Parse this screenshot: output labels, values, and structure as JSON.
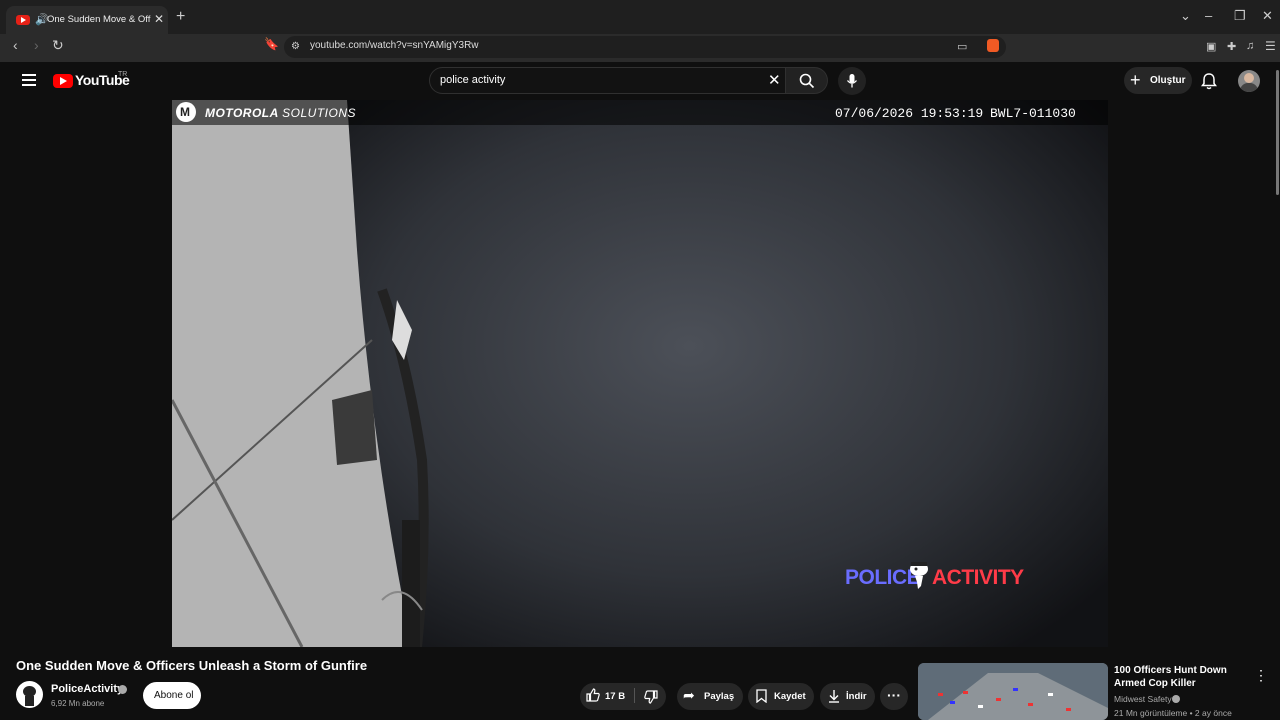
{
  "browser": {
    "tab_title": "One Sudden Move & Officers Unleash a Storm of Gunfire",
    "url": "youtube.com/watch?v=snYAMigY3Rw",
    "icons": [
      "back-icon",
      "forward-icon",
      "reload-icon",
      "bookmark-icon",
      "site-info-icon",
      "cast-icon",
      "brave-shield-icon",
      "extensions-icon",
      "media-icon",
      "menu-icon"
    ]
  },
  "youtube": {
    "logo_text": "YouTube",
    "country_code": "TR",
    "search_value": "police activity",
    "create_label": "Oluştur"
  },
  "video": {
    "overlay_brand": "MOTOROLA",
    "overlay_brand_suffix": "SOLUTIONS",
    "timestamp": "07/06/2026 19:53:19",
    "camera_id": "BWL7-011030",
    "watermark_left": "POLICE",
    "watermark_right": "ACTIVITY",
    "title": "One Sudden Move & Officers Unleash a Storm of Gunfire"
  },
  "channel": {
    "name": "PoliceActivity",
    "subscribers": "6,92 Mn abone",
    "subscribe_label": "Abone ol"
  },
  "actions": {
    "likes": "17 B",
    "share": "Paylaş",
    "save": "Kaydet",
    "download": "İndir"
  },
  "recommendation": {
    "title": "100 Officers Hunt Down Armed Cop Killer",
    "channel": "Midwest Safety",
    "meta": "21 Mn görüntüleme • 2 ay önce"
  },
  "colors": {
    "youtube_red": "#ff0000",
    "background": "#0f0f0f",
    "watermark_blue": "#6a6dff",
    "watermark_red": "#ff3b48"
  }
}
